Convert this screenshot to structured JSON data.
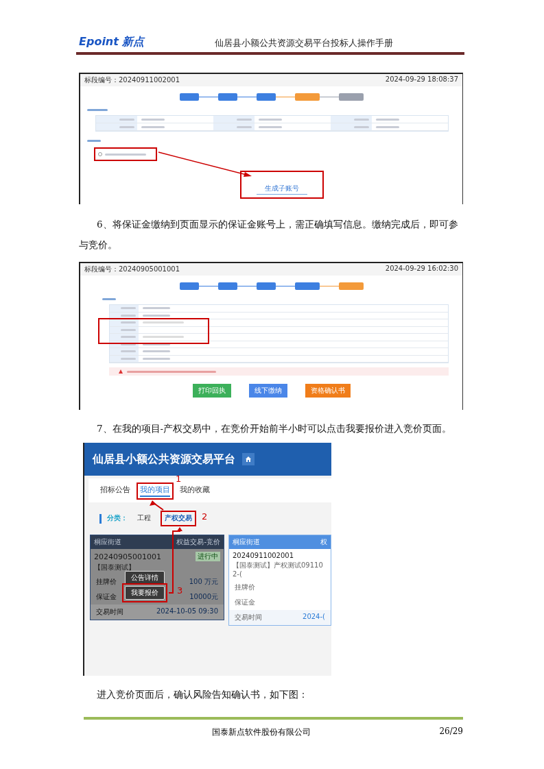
{
  "header": {
    "logo_latin": "Epoint",
    "logo_cjk": "新点",
    "title": "仙居县小额公共资源交易平台投标人操作手册"
  },
  "shot1": {
    "section_no": "标段编号：20240911002001",
    "time": "2024-09-29 18:08:37",
    "steps": [
      {
        "color": "#3d7fe0"
      },
      {
        "color": "#3d7fe0"
      },
      {
        "color": "#3d7fe0"
      },
      {
        "color": "#f39a3a"
      },
      {
        "color": "#9aa0ad"
      }
    ],
    "option": {
      "checked": false
    },
    "button": "生成子账号"
  },
  "step6": "6、将保证金缴纳到页面显示的保证金账号上，需正确填写信息。缴纳完成后，即可参与竞价。",
  "shot2": {
    "section_no": "标段编号：20240905001001",
    "time": "2024-09-29 16:02:30",
    "steps": [
      {
        "color": "#3d7fe0"
      },
      {
        "color": "#3d7fe0"
      },
      {
        "color": "#3d7fe0"
      },
      {
        "color": "#3d7fe0"
      },
      {
        "color": "#f39a3a"
      }
    ],
    "buttons": [
      {
        "label": "打印回执",
        "color": "#3cb05a"
      },
      {
        "label": "线下缴纳",
        "color": "#4a86e8"
      },
      {
        "label": "资格确认书",
        "color": "#f07d1a"
      }
    ]
  },
  "step7": "7、在我的项目-产权交易中，在竞价开始前半小时可以点击我要报价进入竞价页面。",
  "shot3": {
    "title": "仙居县小额公共资源交易平台",
    "tabs": [
      {
        "label": "招标公告",
        "selected": false
      },
      {
        "label": "我的项目",
        "selected": true
      },
      {
        "label": "我的收藏",
        "selected": false
      }
    ],
    "category_label": "分类：",
    "categories": [
      {
        "label": "工程",
        "selected": false
      },
      {
        "label": "产权交易",
        "selected": true
      }
    ],
    "cards": [
      {
        "dimmed": true,
        "area": "桐应街道",
        "type": "权益交易-竞价",
        "number": "20240905001001",
        "status": "进行中",
        "name": "【国泰测试】",
        "actions": [
          "公告详情",
          "我要报价"
        ],
        "rows": [
          {
            "label": "挂牌价",
            "value": "100 万元"
          },
          {
            "label": "保证金",
            "value": "10000元"
          },
          {
            "label": "交易时间",
            "value": "2024-10-05 09:30"
          }
        ]
      },
      {
        "dimmed": false,
        "area": "桐应街道",
        "type": "权",
        "number": "20240911002001",
        "name": "【国泰测试】产权测试091102-(",
        "rows": [
          {
            "label": "挂牌价"
          },
          {
            "label": "保证金"
          },
          {
            "label": "交易时间",
            "value": "2024-("
          }
        ]
      }
    ],
    "marks": [
      "1",
      "2",
      "3"
    ]
  },
  "after": "进入竞价页面后，确认风险告知确认书，如下图：",
  "footer": {
    "company": "国泰新点软件股份有限公司",
    "page": "26/29"
  }
}
